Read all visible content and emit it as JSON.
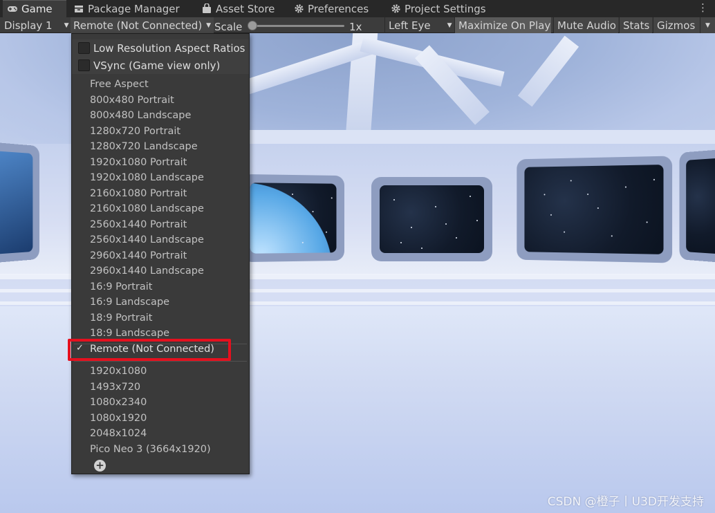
{
  "tabs": [
    {
      "label": "Game",
      "icon": "gamepad-icon",
      "active": true
    },
    {
      "label": "Package Manager",
      "icon": "package-icon",
      "active": false
    },
    {
      "label": "Asset Store",
      "icon": "bag-icon",
      "active": false
    },
    {
      "label": "Preferences",
      "icon": "gear-icon",
      "active": false
    },
    {
      "label": "Project Settings",
      "icon": "gear-icon",
      "active": false
    }
  ],
  "menu_glyph": "⋮",
  "toolbar": {
    "display": "Display 1",
    "aspect": "Remote (Not Connected)",
    "scale_label": "Scale",
    "scale_value": "1x",
    "eye": "Left Eye",
    "maximize": "Maximize On Play",
    "mute": "Mute Audio",
    "stats": "Stats",
    "gizmos": "Gizmos"
  },
  "dropdown": {
    "checks": [
      {
        "label": "Low Resolution Aspect Ratios",
        "checked": false
      },
      {
        "label": "VSync (Game view only)",
        "checked": false
      }
    ],
    "builtin": [
      "Free Aspect",
      "800x480 Portrait",
      "800x480 Landscape",
      "1280x720 Portrait",
      "1280x720 Landscape",
      "1920x1080 Portrait",
      "1920x1080 Landscape",
      "2160x1080 Portrait",
      "2160x1080 Landscape",
      "2560x1440 Portrait",
      "2560x1440 Landscape",
      "2960x1440 Portrait",
      "2960x1440 Landscape",
      "16:9 Portrait",
      "16:9 Landscape",
      "18:9 Portrait",
      "18:9 Landscape"
    ],
    "remote": "Remote (Not Connected)",
    "remote_check": "✓",
    "custom": [
      "1920x1080",
      "1493x720",
      "1080x2340",
      "1080x1920",
      "2048x1024",
      "Pico Neo 3 (3664x1920)"
    ],
    "add_glyph": "+"
  },
  "watermark": "CSDN @橙子丨U3D开发支持",
  "colors": {
    "highlight": "#e5101e",
    "panel": "#3a3a3a",
    "toolbar": "#3c3c3c"
  }
}
